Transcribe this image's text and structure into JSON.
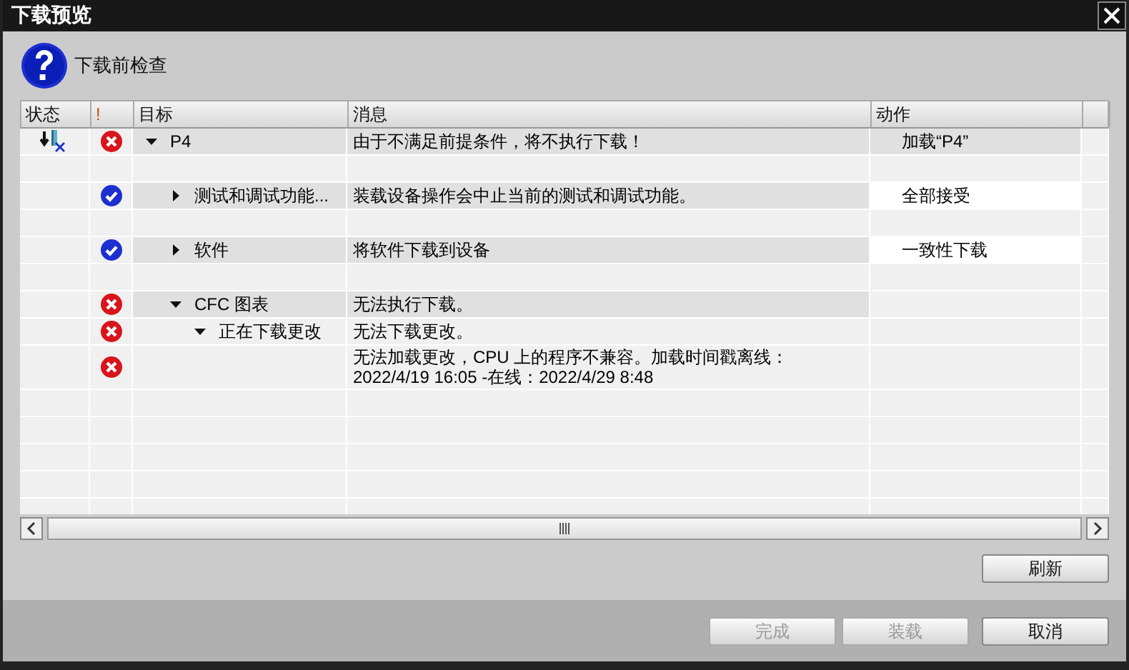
{
  "window": {
    "title": "下载预览"
  },
  "heading": "下载前检查",
  "table": {
    "columns": [
      "状态",
      "!",
      "目标",
      "消息",
      "动作"
    ],
    "rows": [
      {
        "download_blocked": true,
        "kind": "error",
        "target": "P4",
        "toggle": true,
        "expanded": true,
        "shaded": true,
        "message": "由于不满足前提条件，将不执行下载！",
        "action": {
          "text": "加载“P4”",
          "editable": false
        },
        "spacer_after": true,
        "children": [
          {
            "download_blocked": false,
            "kind": "ok",
            "target": "测试和调试功能...",
            "toggle": true,
            "expanded": false,
            "shaded": true,
            "message": "装载设备操作会中止当前的测试和调试功能。",
            "action": {
              "text": "全部接受",
              "editable": true
            },
            "spacer_after": true
          },
          {
            "download_blocked": false,
            "kind": "ok",
            "target": "软件",
            "toggle": true,
            "expanded": false,
            "shaded": true,
            "message": "将软件下载到设备",
            "action": {
              "text": "一致性下载",
              "editable": true
            },
            "spacer_after": true
          },
          {
            "download_blocked": false,
            "kind": "error",
            "target": "CFC 图表",
            "toggle": true,
            "expanded": true,
            "shaded": true,
            "message": "无法执行下载。",
            "spacer_after": false,
            "children": [
              {
                "download_blocked": false,
                "kind": "error",
                "target": "正在下载更改",
                "toggle": true,
                "expanded": true,
                "shaded": false,
                "message": "无法下载更改。",
                "spacer_after": false,
                "children": [
                  {
                    "download_blocked": false,
                    "kind": "error",
                    "toggle": false,
                    "shaded": false,
                    "message": "无法加载更改，CPU 上的程序不兼容。加载时间戳离线：2022/4/19 16:05  -在线：2022/4/29 8:48",
                    "spacer_after": false
                  }
                ]
              }
            ]
          }
        ]
      }
    ]
  },
  "buttons": [
    {
      "label": "刷新",
      "disabled": false
    },
    {
      "label": "完成",
      "disabled": true
    },
    {
      "label": "装载",
      "disabled": true
    },
    {
      "label": "取消",
      "disabled": false
    }
  ]
}
